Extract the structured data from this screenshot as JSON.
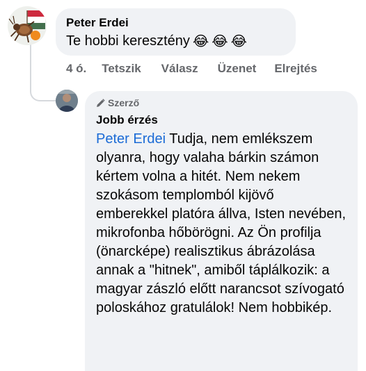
{
  "comment": {
    "author": "Peter Erdei",
    "text": "Te hobbi keresztény",
    "emoji": [
      "😂",
      "😂",
      "😂"
    ],
    "actions": {
      "time": "4 ó.",
      "like": "Tetszik",
      "reply": "Válasz",
      "message": "Üzenet",
      "hide": "Elrejtés"
    }
  },
  "reply": {
    "badge": "Szerző",
    "author": "Jobb érzés",
    "mention": "Peter Erdei",
    "text": "Tudja, nem emlékszem olyanra, hogy valaha bárkin számon kértem volna a hitét. Nem nekem szokásom templomból kijövő emberekkel platóra állva, Isten nevében, mikrofonba hőbörögni. Az Ön profilja (önarcképe) realisztikus ábrázolása annak a \"hitnek\", amiből táplálkozik: a magyar zászló előtt narancsot szívogató poloskához gratulálok! Nem hobbikép."
  },
  "colors": {
    "bubble": "#f0f2f5",
    "mention": "#1b6bd6",
    "secondary_text": "#65676b"
  }
}
